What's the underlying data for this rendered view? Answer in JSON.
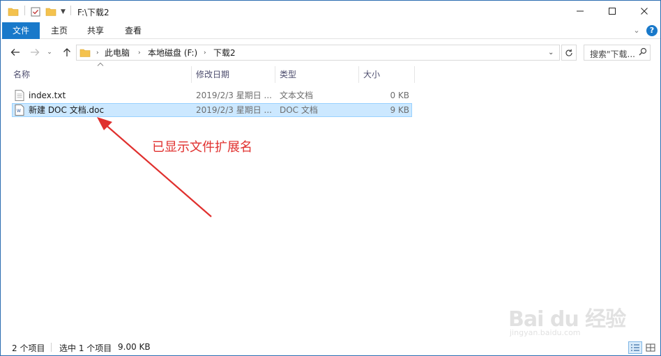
{
  "window": {
    "title": "F:\\下载2"
  },
  "ribbon": {
    "tabs": [
      "文件",
      "主页",
      "共享",
      "查看"
    ]
  },
  "address": {
    "crumbs": [
      "此电脑",
      "本地磁盘 (F:)",
      "下载2"
    ],
    "search_placeholder": "搜索\"下载..."
  },
  "columns": [
    "名称",
    "修改日期",
    "类型",
    "大小"
  ],
  "files": [
    {
      "name": "index.txt",
      "date": "2019/2/3 星期日 ...",
      "type": "文本文档",
      "size": "0 KB",
      "icon": "text-file-icon",
      "selected": false
    },
    {
      "name": "新建 DOC 文档.doc",
      "date": "2019/2/3 星期日 ...",
      "type": "DOC 文档",
      "size": "9 KB",
      "icon": "doc-file-icon",
      "selected": true
    }
  ],
  "annotation": {
    "text": "已显示文件扩展名",
    "color": "#e0302e"
  },
  "watermark": {
    "brand": "Bai du 经验",
    "url": "jingyan.baidu.com"
  },
  "status": {
    "count": "2 个项目",
    "selected": "选中 1 个项目",
    "size": "9.00 KB"
  },
  "colors": {
    "accent": "#1979ca",
    "selection": "#cce8ff",
    "annotation": "#e0302e"
  }
}
